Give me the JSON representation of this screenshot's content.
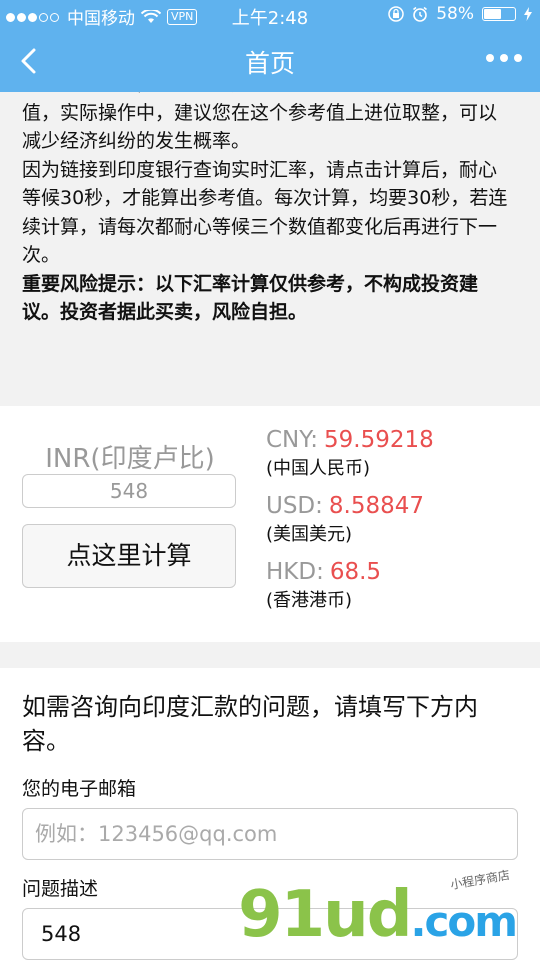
{
  "status_bar": {
    "carrier": "中国移动",
    "vpn": "VPN",
    "time": "上午2:48",
    "battery": "58%",
    "battery_level": 0.58
  },
  "nav": {
    "title": "首页"
  },
  "notice": {
    "paragraph1": "度的卢比数额，右侧为您应该汇出的最低货币款项参考值，实际操作中，建议您在这个参考值上进位取整，可以减少经济纠纷的发生概率。",
    "paragraph2": "因为链接到印度银行查询实时汇率，请点击计算后，耐心等候30秒，才能算出参考值。每次计算，均要30秒，若连续计算，请每次都耐心等候三个数值都变化后再进行下一次。",
    "risk_warning": "重要风险提示：以下汇率计算仅供参考，不构成投资建议。投资者据此买卖，风险自担。"
  },
  "calculator": {
    "inr_label": "INR(印度卢比)",
    "inr_value": "548",
    "calc_button": "点这里计算",
    "rates": [
      {
        "code": "CNY:",
        "value": "59.59218",
        "name": "(中国人民币)"
      },
      {
        "code": "USD:",
        "value": "8.58847",
        "name": "(美国美元)"
      },
      {
        "code": "HKD:",
        "value": "68.5",
        "name": "(香港港币)"
      }
    ]
  },
  "form": {
    "title": "如需咨询向印度汇款的问题，请填写下方内容。",
    "email_label": "您的电子邮箱",
    "email_placeholder": "例如：123456@qq.com",
    "question_label": "问题描述",
    "question_value": "548"
  },
  "watermark": {
    "main": "91ud",
    "tld": ".com",
    "sub": "小程序商店"
  },
  "colors": {
    "accent": "#5fb2ee",
    "rate_value": "#e94f4f"
  }
}
